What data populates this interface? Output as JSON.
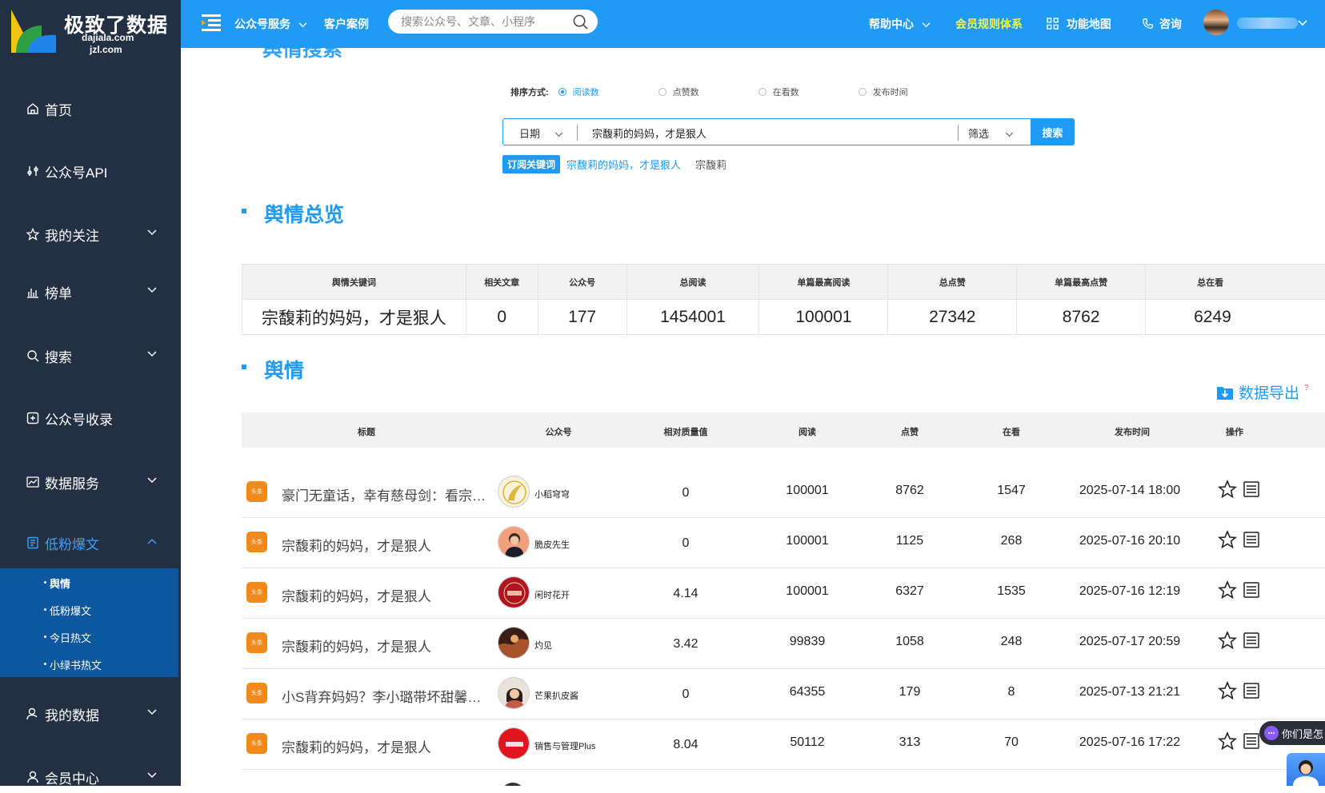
{
  "brand": {
    "name_cn": "极致了数据",
    "domain1": "dajiala.com",
    "domain2": "jzl.com"
  },
  "colors": {
    "primary": "#1f9af5",
    "sidebar": "#233044",
    "submenu": "#0d56a0",
    "tag_orange": "#f08a1c",
    "highlight": "#f3f35a"
  },
  "sidebar": {
    "items": [
      {
        "label": "首页",
        "icon": "home-icon"
      },
      {
        "label": "公众号API",
        "icon": "api-icon"
      },
      {
        "label": "我的关注",
        "icon": "star-icon"
      },
      {
        "label": "榜单",
        "icon": "bar-chart-icon"
      },
      {
        "label": "搜索",
        "icon": "search-icon"
      },
      {
        "label": "公众号收录",
        "icon": "plus-square-icon"
      },
      {
        "label": "数据服务",
        "icon": "line-chart-icon"
      },
      {
        "label": "低粉爆文",
        "icon": "document-icon"
      },
      {
        "label": "我的数据",
        "icon": "user-icon"
      },
      {
        "label": "会员中心",
        "icon": "member-icon"
      }
    ],
    "submenu": [
      {
        "label": "舆情",
        "active": true
      },
      {
        "label": "低粉爆文"
      },
      {
        "label": "今日热文"
      },
      {
        "label": "小绿书热文"
      }
    ]
  },
  "topbar": {
    "service": "公众号服务",
    "cases": "客户案例",
    "search_placeholder": "搜索公众号、文章、小程序",
    "help": "帮助中心",
    "member_rules": "会员规则体系",
    "feature_map": "功能地图",
    "consult": "咨询"
  },
  "search_panel": {
    "sort_label": "排序方式:",
    "sort_options": [
      "阅读数",
      "点赞数",
      "在看数",
      "发布时间"
    ],
    "date_label": "日期",
    "query": "宗馥莉的妈妈，才是狠人",
    "filter_label": "筛选",
    "search_button": "搜索",
    "subscribe_tag": "订阅关键词",
    "keywords": [
      "宗馥莉的妈妈，才是狠人",
      "宗馥莉"
    ]
  },
  "overview": {
    "title": "舆情总览",
    "headers": [
      "舆情关键词",
      "相关文章",
      "公众号",
      "总阅读",
      "单篇最高阅读",
      "总点赞",
      "单篇最高点赞",
      "总在看"
    ],
    "row": [
      "宗馥莉的妈妈，才是狠人",
      "0",
      "177",
      "1454001",
      "100001",
      "27342",
      "8762",
      "6249"
    ]
  },
  "articles": {
    "title": "舆情",
    "export_label": "数据导出",
    "export_hint": "?",
    "headers": [
      "标题",
      "公众号",
      "相对质量值",
      "阅读",
      "点赞",
      "在看",
      "发布时间",
      "操作"
    ],
    "source_tag": "头条",
    "rows": [
      {
        "title": "豪门无童话，幸有慈母剑：看宗馥莉的妈妈如何",
        "account": "小稻穹穹",
        "quality": "0",
        "reads": "100001",
        "likes": "8762",
        "watching": "1547",
        "time": "2025-07-14 18:00"
      },
      {
        "title": "宗馥莉的妈妈，才是狠人",
        "account": "脆皮先生",
        "quality": "0",
        "reads": "100001",
        "likes": "1125",
        "watching": "268",
        "time": "2025-07-16 20:10"
      },
      {
        "title": "宗馥莉的妈妈，才是狠人",
        "account": "闲时花开",
        "quality": "4.14",
        "reads": "100001",
        "likes": "6327",
        "watching": "1535",
        "time": "2025-07-16 12:19"
      },
      {
        "title": "宗馥莉的妈妈，才是狠人",
        "account": "灼见",
        "quality": "3.42",
        "reads": "99839",
        "likes": "1058",
        "watching": "248",
        "time": "2025-07-17 20:59"
      },
      {
        "title": "小S背弃妈妈？李小璐带坏甜馨？宗馥莉的妈妈",
        "account": "芒果扒皮酱",
        "quality": "0",
        "reads": "64355",
        "likes": "179",
        "watching": "8",
        "time": "2025-07-13 21:21"
      },
      {
        "title": "宗馥莉的妈妈，才是狠人",
        "account": "销售与管理Plus",
        "quality": "8.04",
        "reads": "50112",
        "likes": "313",
        "watching": "70",
        "time": "2025-07-16 17:22"
      }
    ]
  },
  "chat_widget": {
    "label": "你们是怎"
  }
}
